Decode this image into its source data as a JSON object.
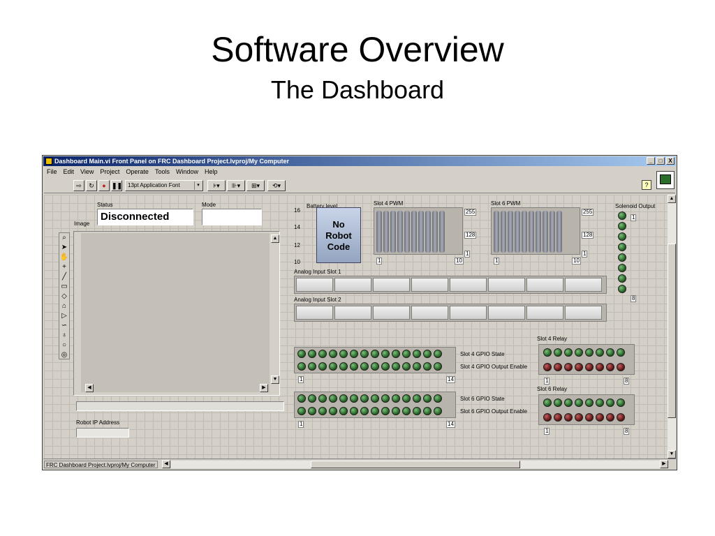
{
  "slide": {
    "title": "Software Overview",
    "subtitle": "The Dashboard"
  },
  "window": {
    "title": "Dashboard Main.vi Front Panel on FRC Dashboard Project.lvproj/My Computer",
    "controls": [
      "_",
      "□",
      "X"
    ],
    "menu": [
      "File",
      "Edit",
      "View",
      "Project",
      "Operate",
      "Tools",
      "Window",
      "Help"
    ],
    "font_select": "13pt Application Font",
    "help": "?"
  },
  "panel": {
    "status_label": "Status",
    "status_value": "Disconnected",
    "mode_label": "Mode",
    "mode_value": "",
    "image_label": "Image",
    "robot_ip_label": "Robot IP Address",
    "robot_ip_value": "",
    "battery_label": "Battery level",
    "battery_ticks": [
      "16",
      "14",
      "12",
      "10"
    ],
    "no_code": [
      "No",
      "Robot",
      "Code"
    ],
    "slot4_pwm": {
      "label": "Slot 4 PWM",
      "ticks": [
        "255",
        "128",
        "1"
      ],
      "x_ticks": [
        "1",
        "10"
      ]
    },
    "slot6_pwm": {
      "label": "Slot 6 PWM",
      "ticks": [
        "255",
        "128",
        "1"
      ],
      "x_ticks": [
        "1",
        "10"
      ]
    },
    "solenoid_label": "Solenoid Output",
    "solenoid_ticks": [
      "1",
      "8"
    ],
    "analog1_label": "Analog Input Slot 1",
    "analog2_label": "Analog Input Slot 2",
    "slot4_gpio_state": "Slot 4 GPIO State",
    "slot4_gpio_output": "Slot 4 GPIO Output Enable",
    "slot6_gpio_state": "Slot 6 GPIO State",
    "slot6_gpio_output": "Slot 6 GPIO Output Enable",
    "gpio_ticks": [
      "1",
      "14"
    ],
    "slot4_relay": "Slot 4 Relay",
    "slot6_relay": "Slot 6 Relay",
    "relay_ticks": [
      "1",
      "8"
    ]
  },
  "statusbar": {
    "path": "FRC Dashboard Project.lvproj/My Computer"
  }
}
